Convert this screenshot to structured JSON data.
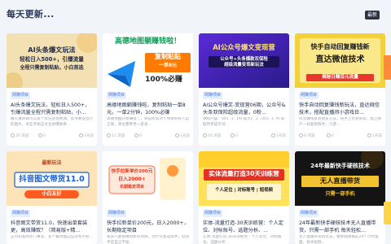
{
  "header": {
    "title": "每天更新...",
    "latest_button": "最新"
  },
  "cards": [
    {
      "thumb_lines": [
        "AI头条爆文玩法",
        "轻松日入500+，引爆流量",
        "全程只需复制粘贴，小白首选"
      ],
      "tag": "网赚项目",
      "title": "AI头条爆文玩法，轻松日入500+，引爆流量全程只需复制粘贴，小...",
      "desc": "做火爆项目可以多个年任多免费课。此项要多出行的图片，冬在开始这文主讲爆款目...",
      "views": "26 浏览",
      "comments": "0",
      "date": "1天前"
    },
    {
      "thumb_lines": [
        "高德地图躺赚钱啦！",
        "复制粘贴",
        "一单8元",
        "100%必赚"
      ],
      "tag": "网赚项目",
      "title": "高德地图躺赚钱啦，复制粘贴一单8元，一单2分钟，100%必赚",
      "desc": "高德地图开始赚钱了，目前阶段对个项目好有人自己来，单位都参考一定会...",
      "views": "11 浏览",
      "comments": "0",
      "date": "1天前"
    },
    {
      "thumb_lines": [
        "AI公众号爆文变现营",
        "公众号+头条爆款双保险",
        "超级流量变现新玩法"
      ],
      "tag": "网赚项目",
      "title": "AI公众号爆文-变现营06期，公众号&头条双保险超级流量，0粉...",
      "desc": "课程内容：001. 1.【AI 提示】 2...001. 1. AI 获取所有提示词...",
      "views": "16 浏览",
      "comments": "0",
      "date": "1天前"
    },
    {
      "thumb_lines": [
        "快手自动回复赚钱新",
        "直达微信技术",
        "揭秘日赚百元流量"
      ],
      "tag": "网赚项目",
      "title": "快手自动回复赚钱新玩法，直达微信技术，搭配直播间小游戏日...",
      "desc": "抖音赚钱就有很多方法，快手上也有很多，加上用户一日复到快手，小游...",
      "views": "9 浏览",
      "comments": "0",
      "date": "1天前"
    },
    {
      "thumb_lines": [
        "抖音图文带货11.0",
        "最新玩法",
        "小白友好"
      ],
      "tag": "网赚项目",
      "title": "抖音图文带货11.0，快速出单套装更，高效赚取？（简易版+精...",
      "desc": "五月初发热点门事业，多个雅项面这些没有不好...",
      "views": "7 浏览",
      "comments": "0",
      "date": "2天前"
    },
    {
      "thumb_lines": [
        "快手拉新单价200元",
        "日入2000+",
        "长期稳定项目"
      ],
      "tag": "网赚项目",
      "title": "快手拉新单价200元，日入2000+，长期稳定项目",
      "desc": "很多人都很做拉新的项目，为什么会选快手，但快手是自己不知...",
      "views": "9 浏览",
      "comments": "0",
      "date": "2天前"
    },
    {
      "thumb_lines": [
        "实体流量打造30天训练营",
        "个人定位 | 对标账号 | 短视频"
      ],
      "tag": "网赚项目",
      "title": "实体-流量打造-30天训练营：个人定位、对标账号、选题分析、...",
      "desc": "实体-流量打造-30天训练营：个人定位、对标账号、选题分析...",
      "views": "8 浏览",
      "comments": "0",
      "date": "2天前"
    },
    {
      "thumb_lines": [
        "24年最新快手硬核技术",
        "无人直播带货",
        "只需一部手机"
      ],
      "tag": "网赚项目",
      "title": "24年最新快手硬核技术无人直播带货，只需一部手机 每天轻松...",
      "desc": "无人直播带货的玩法，整体视频都在24个小时里面，技术视频...",
      "views": "5 浏览",
      "comments": "0",
      "date": "2天前"
    }
  ]
}
